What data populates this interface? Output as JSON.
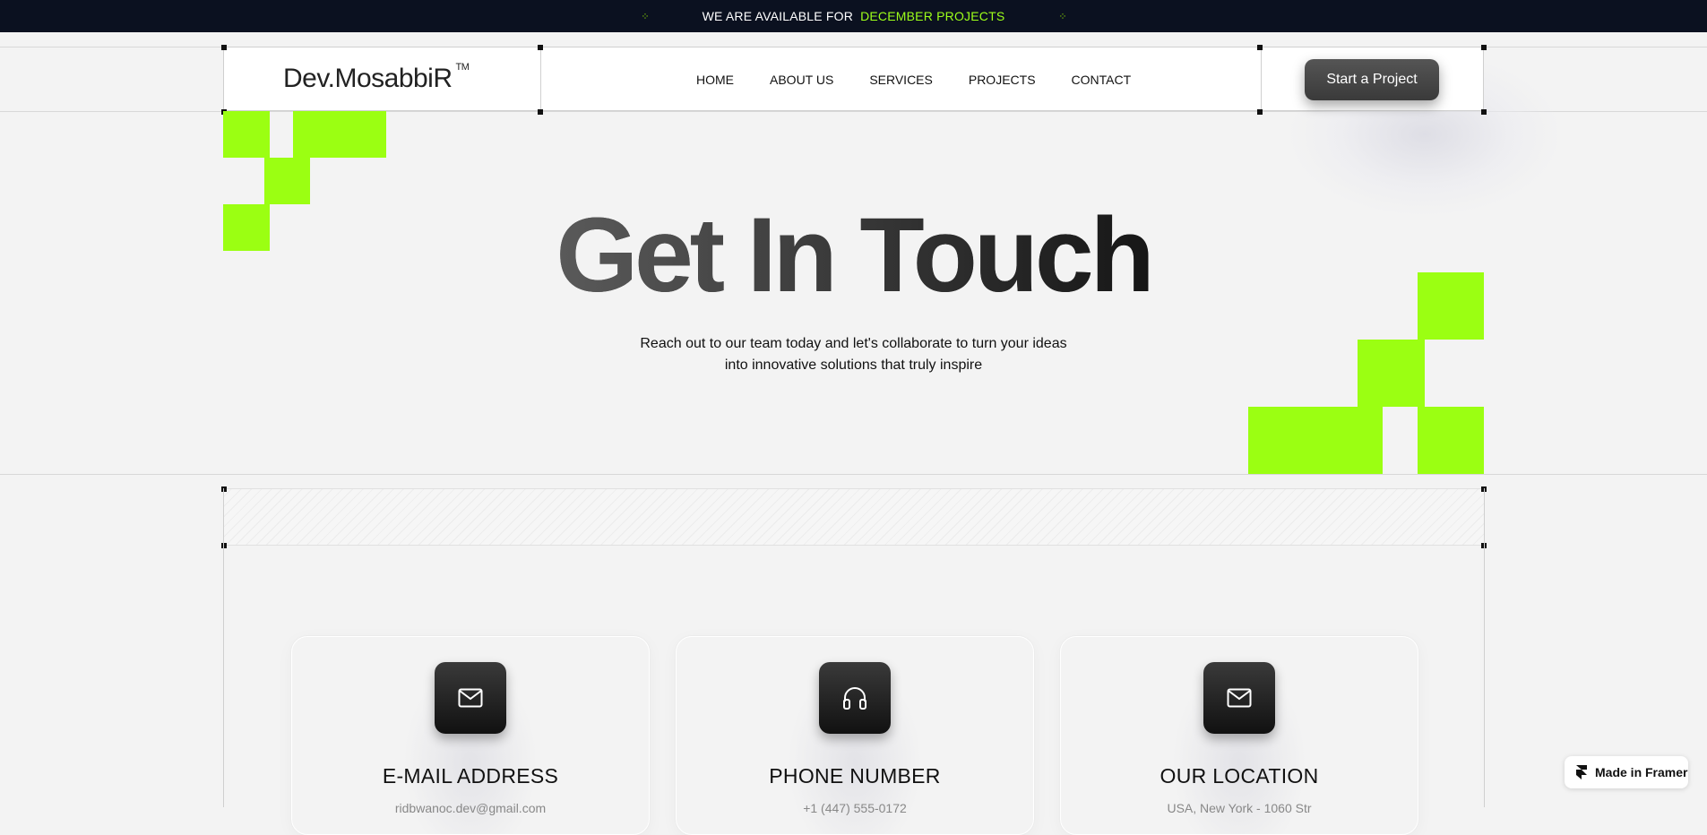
{
  "announcement": {
    "prefix": "WE ARE AVAILABLE FOR",
    "highlight": "DECEMBER PROJECTS"
  },
  "header": {
    "logo": "Dev.MosabbiR",
    "logo_tm": "TM",
    "nav": [
      "HOME",
      "ABOUT US",
      "SERVICES",
      "PROJECTS",
      "CONTACT"
    ],
    "cta": "Start a Project"
  },
  "hero": {
    "title": "Get In Touch",
    "subtitle_line1": "Reach out to our team today and let's collaborate to turn your ideas",
    "subtitle_line2": "into innovative solutions that truly inspire"
  },
  "cards": [
    {
      "icon": "mail-icon",
      "label": "E-MAIL ADDRESS",
      "value": "ridbwanoc.dev@gmail.com"
    },
    {
      "icon": "headphones-icon",
      "label": "PHONE NUMBER",
      "value": "+1 (447) 555-0172"
    },
    {
      "icon": "mail-icon",
      "label": "OUR LOCATION",
      "value": "USA, New York - 1060 Str"
    }
  ],
  "badge": {
    "label": "Made in Framer"
  },
  "colors": {
    "accent": "#9bff12",
    "topbar": "#0b1120",
    "button": "#444444"
  }
}
